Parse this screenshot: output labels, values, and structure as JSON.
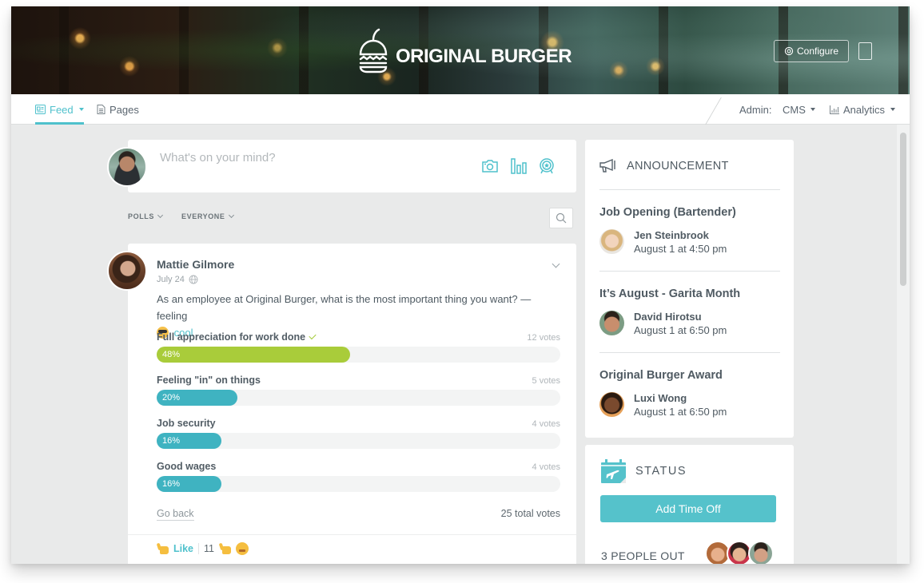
{
  "banner": {
    "brand_name": "ORIGINAL BURGER",
    "configure_label": "Configure",
    "icons": {
      "logo": "burger-apple-logo",
      "configure": "gear-icon",
      "device": "tablet-icon"
    }
  },
  "navbar": {
    "tabs": [
      {
        "label": "Feed",
        "icon": "feed-icon",
        "active": true,
        "has_dropdown": true
      },
      {
        "label": "Pages",
        "icon": "page-icon",
        "active": false,
        "has_dropdown": false
      }
    ],
    "admin_label": "Admin:",
    "cms_label": "CMS",
    "analytics_label": "Analytics"
  },
  "composer": {
    "placeholder": "What's on your mind?",
    "actions": [
      "camera-icon",
      "poll-icon",
      "award-icon"
    ]
  },
  "filters": {
    "type_label": "POLLS",
    "audience_label": "EVERYONE"
  },
  "post": {
    "author": "Mattie Gilmore",
    "date": "July 24",
    "visibility_icon": "globe-icon",
    "text": "As an employee at Original Burger, what is the most important thing you want? — feeling",
    "feeling": "cool",
    "poll": {
      "options": [
        {
          "label": "Full appreciation for work done",
          "votes_label": "12 votes",
          "percent": 48,
          "percent_label": "48%",
          "selected": true,
          "color": "#a9cc3a"
        },
        {
          "label": "Feeling \"in\" on things",
          "votes_label": "5 votes",
          "percent": 20,
          "percent_label": "20%",
          "selected": false,
          "color": "#3fb3c1"
        },
        {
          "label": "Job security",
          "votes_label": "4 votes",
          "percent": 16,
          "percent_label": "16%",
          "selected": false,
          "color": "#3fb3c1"
        },
        {
          "label": "Good wages",
          "votes_label": "4 votes",
          "percent": 16,
          "percent_label": "16%",
          "selected": false,
          "color": "#3fb3c1"
        }
      ],
      "go_back_label": "Go back",
      "total_votes_label": "25 total votes"
    },
    "actions": {
      "like_label": "Like",
      "reaction_count": "11"
    }
  },
  "announcement": {
    "title": "ANNOUNCEMENT",
    "items": [
      {
        "title": "Job Opening (Bartender)",
        "author": "Jen Steinbrook",
        "time": "August 1 at 4:50 pm"
      },
      {
        "title": "It’s August - Garita Month",
        "author": "David Hirotsu",
        "time": "August 1 at 6:50 pm"
      },
      {
        "title": "Original Burger Award",
        "author": "Luxi Wong",
        "time": "August 1 at 6:50 pm"
      }
    ]
  },
  "status": {
    "title": "STATUS",
    "add_time_off_label": "Add Time Off",
    "people_out_label": "3 PEOPLE OUT"
  },
  "colors": {
    "accent": "#4fc1cc",
    "poll_selected": "#a9cc3a",
    "poll_default": "#3fb3c1",
    "button": "#55c2cb",
    "background": "#e9eaea"
  }
}
